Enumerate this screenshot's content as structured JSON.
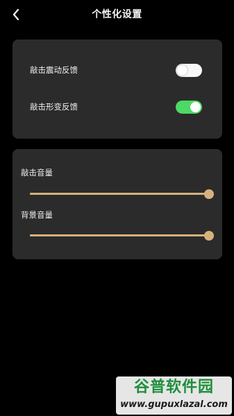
{
  "header": {
    "title": "个性化设置",
    "back_icon": "chevron-left-icon"
  },
  "settings_card": {
    "items": [
      {
        "label": "敲击震动反馈",
        "enabled": false
      },
      {
        "label": "敲击形变反馈",
        "enabled": true
      }
    ]
  },
  "volume_card": {
    "sliders": [
      {
        "label": "敲击音量",
        "value_percent": 100
      },
      {
        "label": "背景音量",
        "value_percent": 100
      }
    ]
  },
  "colors": {
    "background": "#000000",
    "card": "#2b2b2b",
    "switch_on": "#4cd964",
    "slider": "#d8b07e"
  },
  "watermark": {
    "brand": "谷普软件园",
    "url": "www.gupuxlazal.com"
  }
}
